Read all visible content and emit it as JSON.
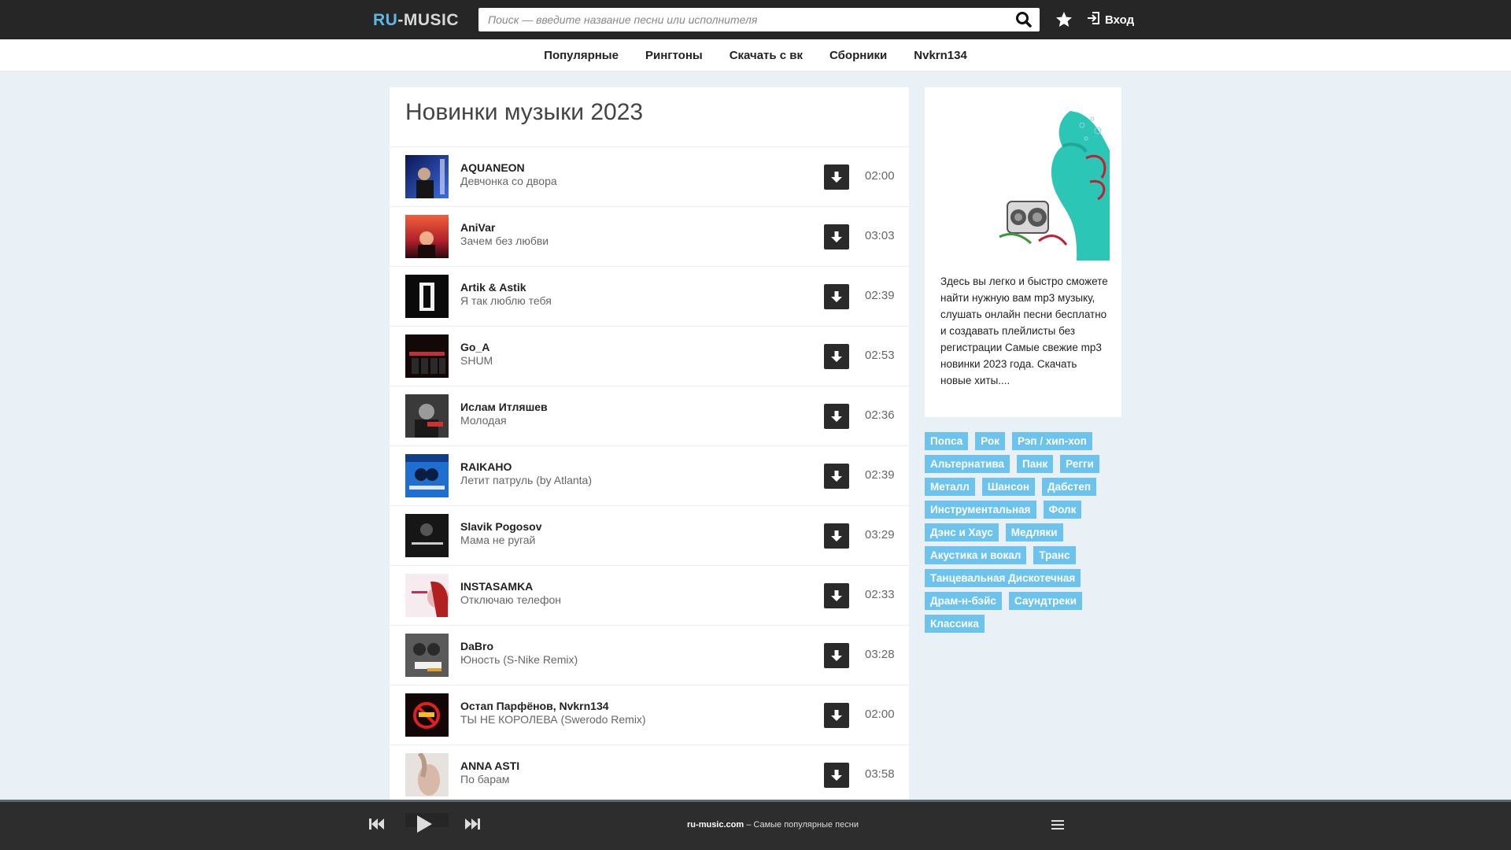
{
  "header": {
    "logo_ru": "RU",
    "logo_rest": "-MUSIC",
    "search_placeholder": "Поиск — введите название песни или исполнителя",
    "login_label": "Вход"
  },
  "nav": [
    {
      "label": "Популярные"
    },
    {
      "label": "Рингтоны"
    },
    {
      "label": "Скачать с вк"
    },
    {
      "label": "Сборники"
    },
    {
      "label": "Nvkrn134"
    }
  ],
  "main": {
    "title": "Новинки музыки 2023",
    "tracks": [
      {
        "artist": "AQUANEON",
        "title": "Девчонка со двора",
        "duration": "02:00"
      },
      {
        "artist": "AniVar",
        "title": "Зачем без любви",
        "duration": "03:03"
      },
      {
        "artist": "Artik & Astik",
        "title": "Я так люблю тебя",
        "duration": "02:39"
      },
      {
        "artist": "Go_A",
        "title": "SHUM",
        "duration": "02:53"
      },
      {
        "artist": "Ислам Итляшев",
        "title": "Молодая",
        "duration": "02:36"
      },
      {
        "artist": "RAIKAHO",
        "title": "Летит патруль (by Atlanta)",
        "duration": "02:39"
      },
      {
        "artist": "Slavik Pogosov",
        "title": "Мама не ругай",
        "duration": "03:29"
      },
      {
        "artist": "INSTASAMKA",
        "title": "Отключаю телефон",
        "duration": "02:33"
      },
      {
        "artist": "DaBro",
        "title": "Юность (S-Nike Remix)",
        "duration": "03:28"
      },
      {
        "artist": "Остап Парфёнов, Nvkrn134",
        "title": "ТЫ НЕ КОРОЛЕВА (Swerodo Remix)",
        "duration": "02:00"
      },
      {
        "artist": "ANNA ASTI",
        "title": "По барам",
        "duration": "03:58"
      },
      {
        "artist": "",
        "title": "",
        "duration": ""
      }
    ]
  },
  "sidebar": {
    "description": "Здесь вы легко и быстро сможете найти нужную вам mp3 музыку, слушать онлайн песни бесплатно и создавать плейлисты без регистрации Самые свежие mp3 новинки 2023 года. Скачать новые хиты....",
    "genres": [
      "Попса",
      "Рок",
      "Рэп / хип-хоп",
      "Альтернатива",
      "Панк",
      "Регги",
      "Металл",
      "Шансон",
      "Дабстеп",
      "Инструментальная",
      "Фолк",
      "Дэнс и Хаус",
      "Медляки",
      "Акустика и вокал",
      "Транс",
      "Танцевальная Дискотечная",
      "Драм-н-бэйс",
      "Саундтреки",
      "Классика"
    ]
  },
  "player": {
    "site": "ru-music.com",
    "tagline": " – Самые популярные песни"
  },
  "colors": {
    "accent": "#6cc3ee",
    "header_bg": "#262626",
    "page_bg": "#e9f0f6"
  }
}
